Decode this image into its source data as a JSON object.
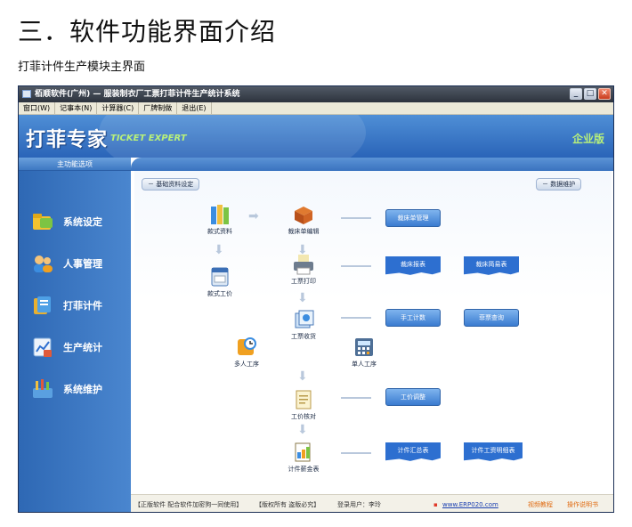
{
  "doc": {
    "title": "三．软件功能界面介绍",
    "subtitle": "打菲计件生产模块主界面"
  },
  "window": {
    "title": "栢顺软件(广州) — 服装制衣厂工票打菲计件生产统计系统",
    "menu": [
      "窗口(W)",
      "记事本(N)",
      "计算器(C)",
      "厂牌制做",
      "退出(E)"
    ]
  },
  "banner": {
    "brand": "打菲专家",
    "brand_en": "TICKET EXPERT",
    "edition": "企业版"
  },
  "sidebar": {
    "header": "主功能选项",
    "items": [
      {
        "label": "系统设定",
        "icon": "folder-icon"
      },
      {
        "label": "人事管理",
        "icon": "users-icon"
      },
      {
        "label": "打菲计件",
        "icon": "tickets-icon"
      },
      {
        "label": "生产统计",
        "icon": "chart-icon"
      },
      {
        "label": "系统维护",
        "icon": "tools-icon"
      }
    ]
  },
  "main": {
    "basic_settings": "基础资料设定",
    "data_maintenance": "数据维护",
    "nodes": {
      "style_data": "款式资料",
      "bed_ticket_edit": "裁床单编辑",
      "style_price": "款式工价",
      "ticket_print": "工票打印",
      "ticket_receive": "工票收货",
      "multi_process": "多人工序",
      "single_process": "单人工序",
      "price_check": "工价核对",
      "piece_wage_table": "计件薪金表"
    },
    "buttons": {
      "bed_ticket_manage": "裁床单管理",
      "bed_report": "裁床报表",
      "bed_simple": "裁床简易表",
      "manual_count": "手工计数",
      "ticket_query": "菲票查询",
      "price_adjust": "工价调整",
      "piece_summary": "计件汇总表",
      "piece_wage_detail": "计件工资明细表"
    }
  },
  "status": {
    "license": "【正版软件 配合软件加密狗一同使用】",
    "copyright": "【版权所有 盗版必究】",
    "user": "登录用户：李玲",
    "website": "www.ERP020.com",
    "video": "视频教程",
    "manual": "操作说明书"
  },
  "colors": {
    "banner_blue": "#3a73bf",
    "button_blue": "#3a7bd0",
    "accent_green": "#b8f07a",
    "status_orange": "#e06a10"
  }
}
